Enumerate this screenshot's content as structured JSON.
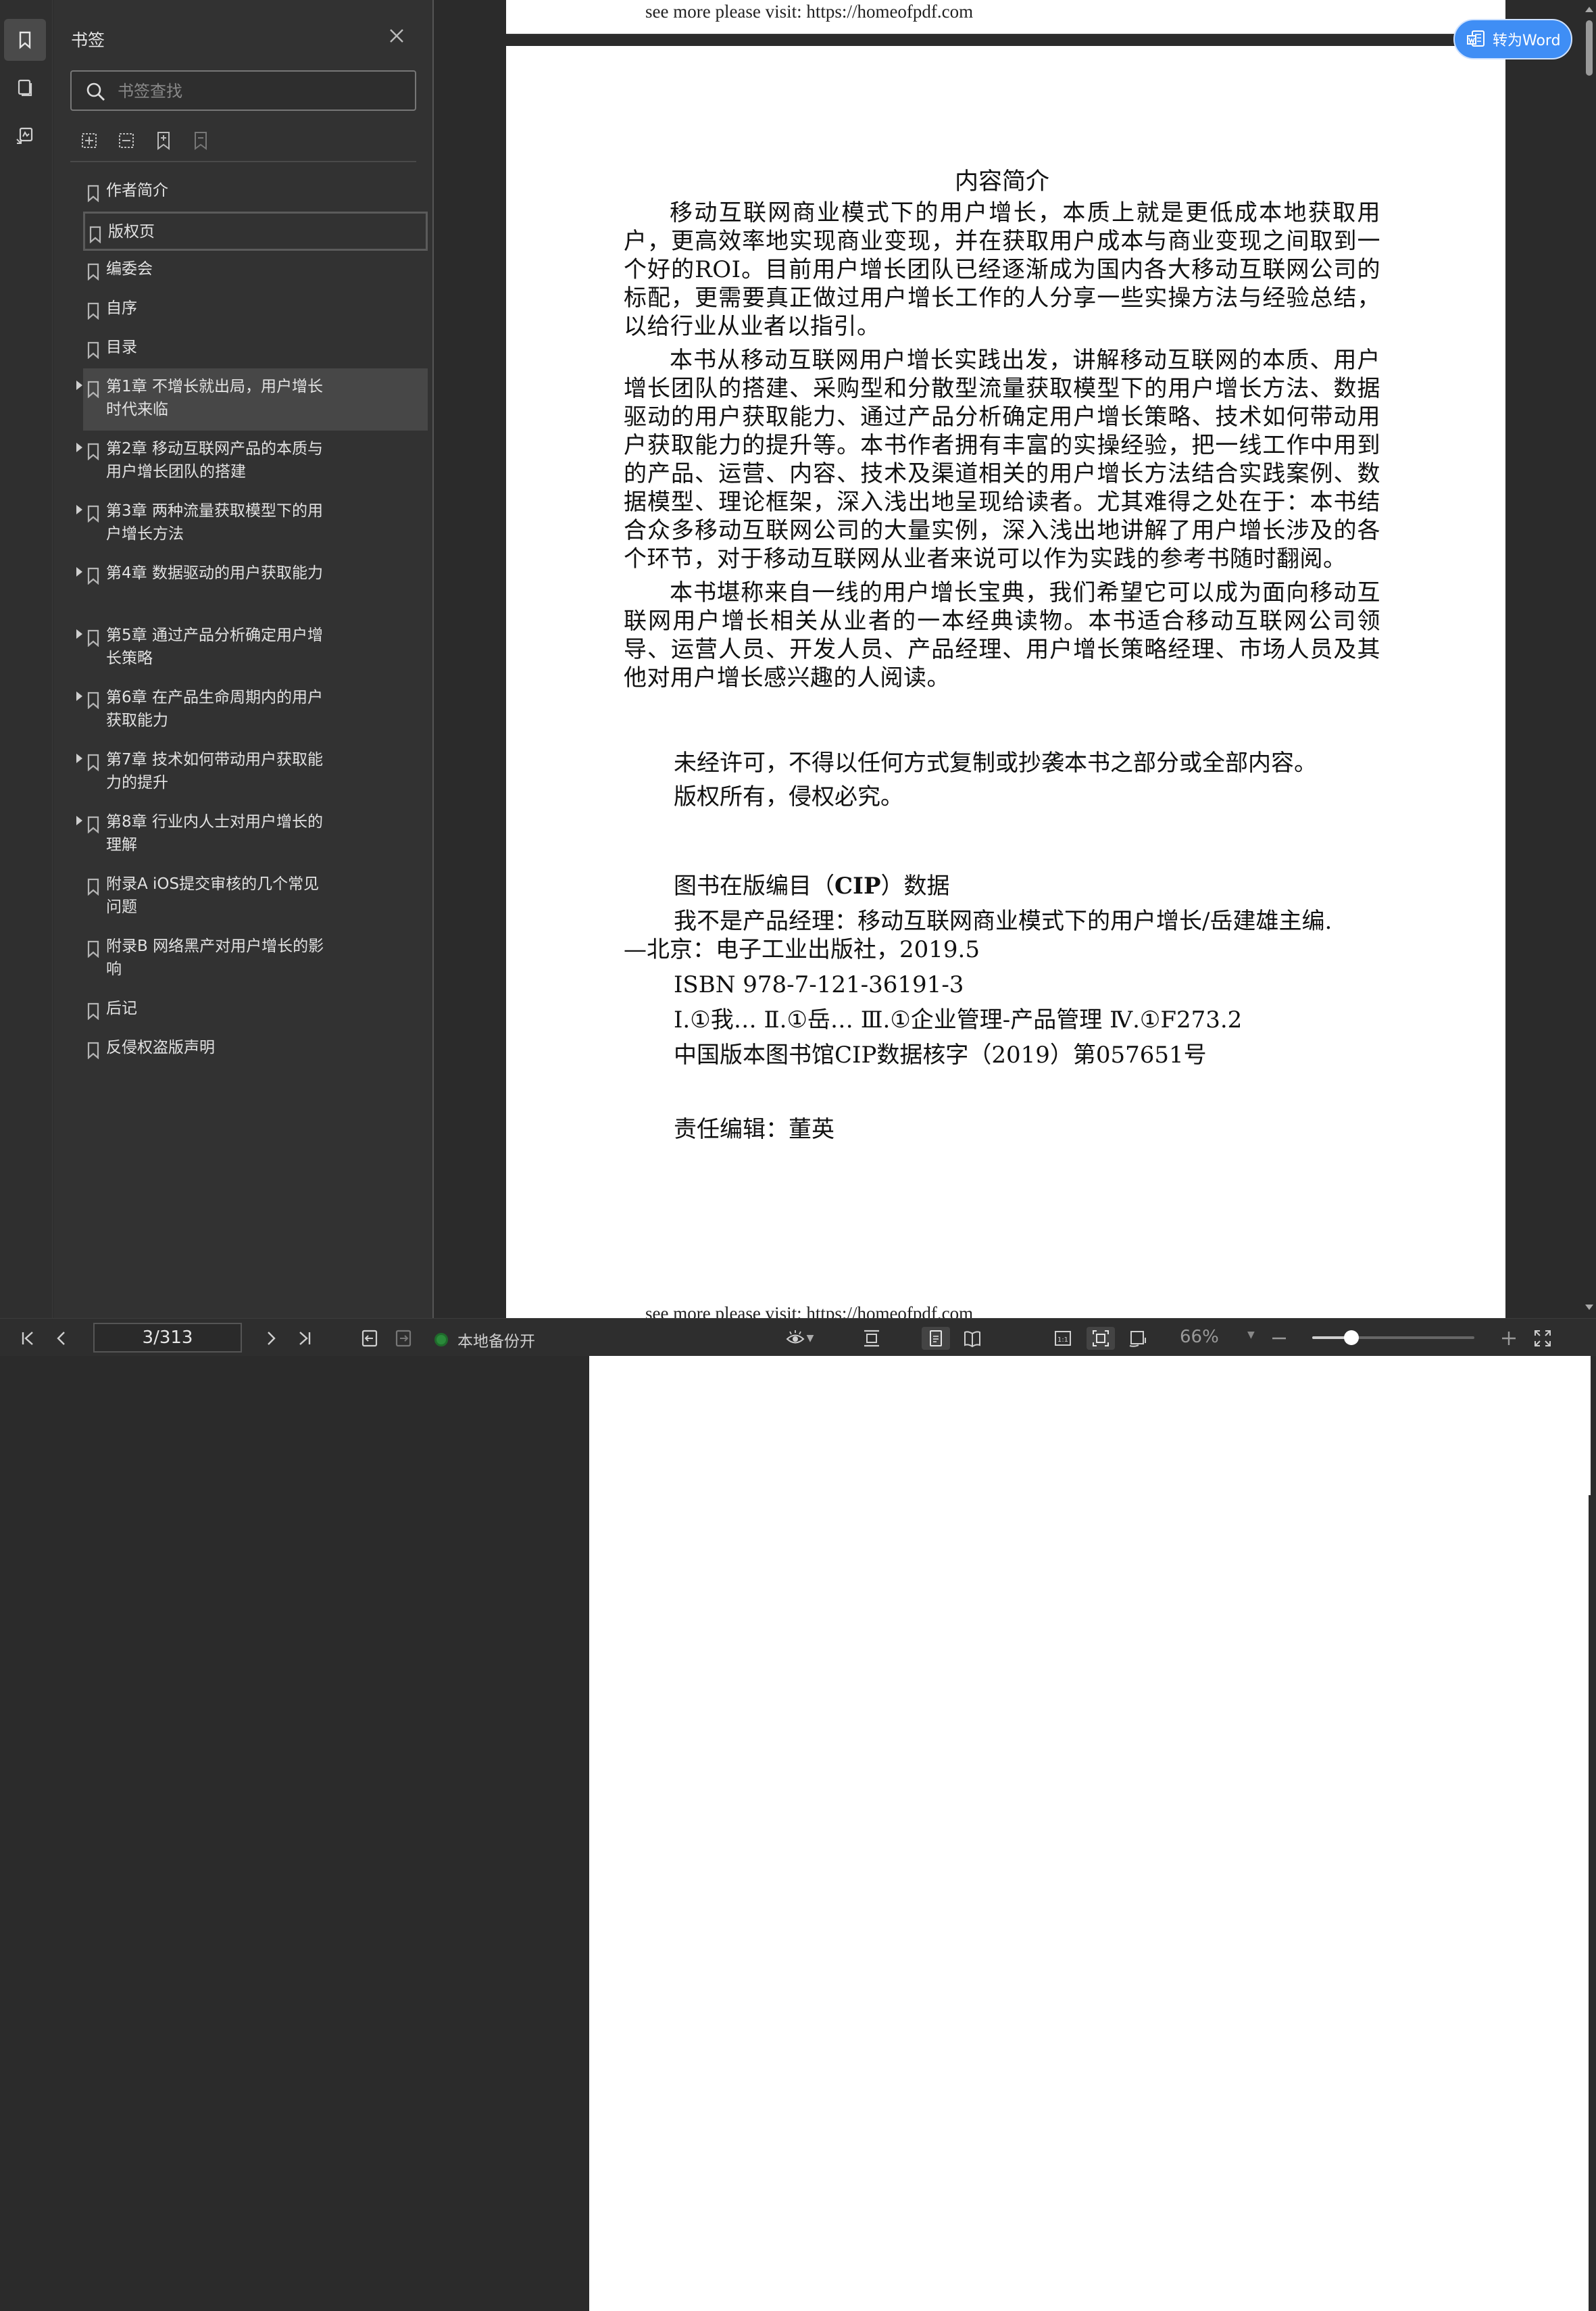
{
  "rail": {
    "items": [
      {
        "name": "bookmark-rail-icon",
        "active": true
      },
      {
        "name": "thumbnail-rail-icon",
        "active": false
      },
      {
        "name": "annotation-rail-icon",
        "active": false
      }
    ]
  },
  "panel": {
    "title": "书签",
    "search_placeholder": "书签查找"
  },
  "bookmarks": [
    {
      "label": "作者简介",
      "page": "2",
      "expandable": false
    },
    {
      "label": "版权页",
      "page": "3",
      "expandable": false,
      "selected": true
    },
    {
      "label": "编委会",
      "page": "5",
      "expandable": false
    },
    {
      "label": "自序",
      "page": "6",
      "expandable": false
    },
    {
      "label": "目录",
      "page": "12",
      "expandable": false
    },
    {
      "label": "第1章 不增长就出局，用户增长时代来临",
      "page": "16",
      "expandable": true,
      "hover": true
    },
    {
      "label": "第2章 移动互联网产品的本质与用户增长团队的搭建",
      "page": "26",
      "expandable": true
    },
    {
      "label": "第3章 两种流量获取模型下的用户增长方法",
      "page": "51",
      "expandable": true
    },
    {
      "label": "第4章 数据驱动的用户获取能力",
      "page": "85",
      "expandable": true
    },
    {
      "label": "第5章 通过产品分析确定用户增长策略",
      "page": "149",
      "expandable": true
    },
    {
      "label": "第6章 在产品生命周期内的用户获取能力",
      "page": "185",
      "expandable": true
    },
    {
      "label": "第7章 技术如何带动用户获取能力的提升",
      "page": "197",
      "expandable": true
    },
    {
      "label": "第8章 行业内人士对用户增长的理解",
      "page": "258",
      "expandable": true
    },
    {
      "label": "附录A iOS提交审核的几个常见问题",
      "page": "289",
      "expandable": false
    },
    {
      "label": "附录B 网络黑产对用户增长的影响",
      "page": "300",
      "expandable": false
    },
    {
      "label": "后记",
      "page": "308",
      "expandable": false
    },
    {
      "label": "反侵权盗版声明",
      "page": "310",
      "expandable": false
    }
  ],
  "document": {
    "header_text": "see more please visit: https://homeofpdf.com",
    "heading": "内容简介",
    "paragraphs": [
      "移动互联网商业模式下的用户增长，本质上就是更低成本地获取用户，更高效率地实现商业变现，并在获取用户成本与商业变现之间取到一个好的ROI。目前用户增长团队已经逐渐成为国内各大移动互联网公司的标配，更需要真正做过用户增长工作的人分享一些实操方法与经验总结，以给行业从业者以指引。",
      "本书从移动互联网用户增长实践出发，讲解移动互联网的本质、用户增长团队的搭建、采购型和分散型流量获取模型下的用户增长方法、数据驱动的用户获取能力、通过产品分析确定用户增长策略、技术如何带动用户获取能力的提升等。本书作者拥有丰富的实操经验，把一线工作中用到的产品、运营、内容、技术及渠道相关的用户增长方法结合实践案例、数据模型、理论框架，深入浅出地呈现给读者。尤其难得之处在于：本书结合众多移动互联网公司的大量实例，深入浅出地讲解了用户增长涉及的各个环节，对于移动互联网从业者来说可以作为实践的参考书随时翻阅。",
      "本书堪称来自一线的用户增长宝典，我们希望它可以成为面向移动互联网用户增长相关从业者的一本经典读物。本书适合移动互联网公司领导、运营人员、开发人员、产品经理、用户增长策略经理、市场人员及其他对用户增长感兴趣的人阅读。"
    ],
    "copyright_1": "未经许可，不得以任何方式复制或抄袭本书之部分或全部内容。",
    "copyright_2": "版权所有，侵权必究。",
    "cip_title_pre": "图书在版编目（",
    "cip_title_bold": "CIP",
    "cip_title_post": "）数据",
    "cip_line1": "我不是产品经理：移动互联网商业模式下的用户增长/岳建雄主编.",
    "cip_line2": "—北京：电子工业出版社，2019.5",
    "isbn": "ISBN 978-7-121-36191-3",
    "classification": "Ⅰ.①我… Ⅱ.①岳… Ⅲ.①企业管理-产品管理 Ⅳ.①F273.2",
    "cip_number": "中国版本图书馆CIP数据核字（2019）第057651号",
    "editor": "责任编辑：董英"
  },
  "to_word_label": "转为Word",
  "bottom": {
    "page_indicator": "3/313",
    "backup_text": "本地备份开",
    "zoom": "66%",
    "zoom_fraction": 0.24
  },
  "colors": {
    "accent": "#3f8ef5",
    "panel_bg": "#323232",
    "app_bg": "#2b2b2b",
    "status_green": "#2a8a3a"
  }
}
